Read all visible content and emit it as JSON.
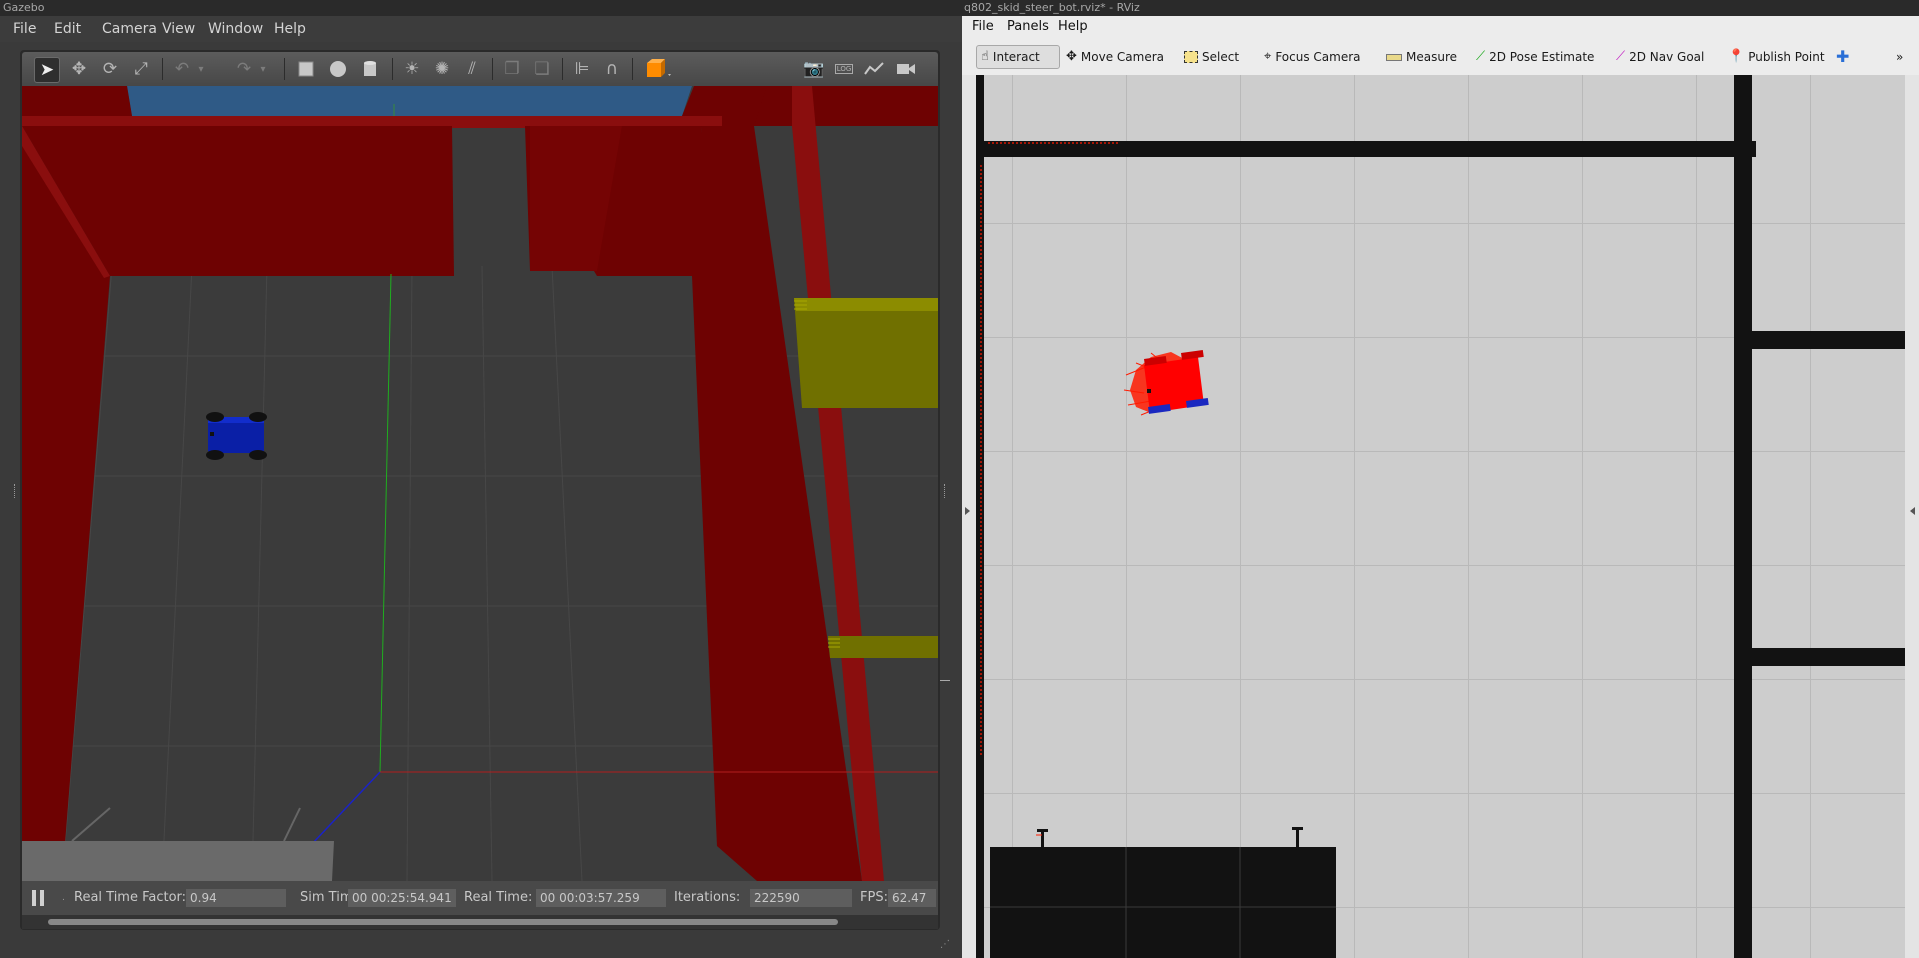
{
  "gazebo": {
    "window_title": "Gazebo",
    "menu": [
      "File",
      "Edit",
      "Camera",
      "View",
      "Window",
      "Help"
    ],
    "toolbar_icons": [
      "select-arrow-icon",
      "translate-icon",
      "rotate-icon",
      "scale-icon",
      "undo-icon",
      "undo-history-icon",
      "redo-icon",
      "redo-history-icon",
      "box-icon",
      "sphere-icon",
      "cylinder-icon",
      "point-light-icon",
      "spot-light-icon",
      "directional-light-icon",
      "copy-icon",
      "paste-icon",
      "align-icon",
      "snap-magnet-icon",
      "view-angle-icon",
      "screenshot-icon",
      "log-icon",
      "plot-icon",
      "video-record-icon"
    ],
    "log_label": "LOG",
    "status": {
      "real_time_factor_label": "Real Time Factor:",
      "real_time_factor": "0.94",
      "sim_time_label": "Sim Time:",
      "sim_time": "00 00:25:54.941",
      "real_time_label": "Real Time:",
      "real_time": "00 00:03:57.259",
      "iterations_label": "Iterations:",
      "iterations": "222590",
      "fps_label": "FPS:",
      "fps": "62.47"
    },
    "colors": {
      "wall": "#6e0202",
      "robot": "#0a1fa6",
      "yellow_obstacle": "#707000",
      "floor": "#3b3b3b"
    }
  },
  "rviz": {
    "window_title": "q802_skid_steer_bot.rviz* - RViz",
    "menu": [
      "File",
      "Panels",
      "Help"
    ],
    "tools": [
      {
        "label": "Interact",
        "icon": "hand-cursor-icon",
        "active": true
      },
      {
        "label": "Move Camera",
        "icon": "move-camera-icon",
        "active": false
      },
      {
        "label": "Select",
        "icon": "select-box-icon",
        "active": false
      },
      {
        "label": "Focus Camera",
        "icon": "focus-camera-icon",
        "active": false
      },
      {
        "label": "Measure",
        "icon": "ruler-icon",
        "active": false
      },
      {
        "label": "2D Pose Estimate",
        "icon": "pose-estimate-arrow-icon",
        "active": false
      },
      {
        "label": "2D Nav Goal",
        "icon": "nav-goal-arrow-icon",
        "active": false
      },
      {
        "label": "Publish Point",
        "icon": "map-pin-icon",
        "active": false
      }
    ],
    "add_tool_icon": "plus-crosshair-icon",
    "overflow_label": "»",
    "colors": {
      "map_free": "#c9c9c9",
      "map_occupied": "#121212",
      "laser": "#ff1a00",
      "robot": "#ff0000"
    }
  }
}
